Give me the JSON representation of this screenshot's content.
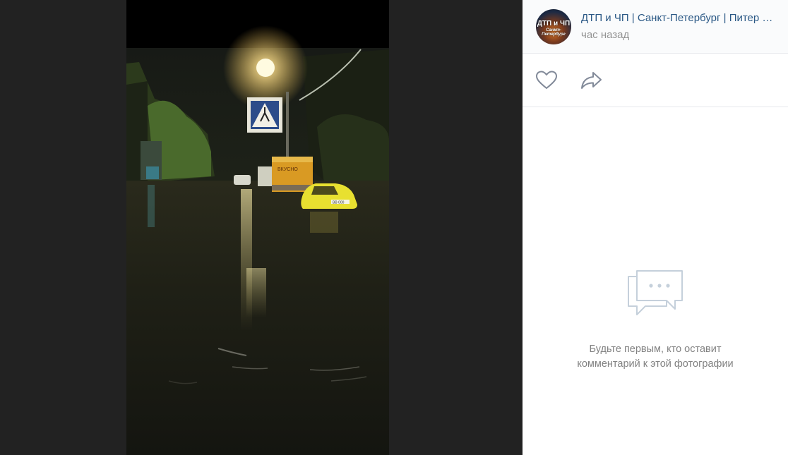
{
  "group": {
    "avatar_line1": "ДТП и ЧП",
    "avatar_line2": "Санкт-Петербург",
    "name": "ДТП и ЧП | Санкт-Петербург | Питер Онлайн | СПб",
    "time": "час назад"
  },
  "photo": {
    "car_plate": "ВВ 000"
  },
  "actions": {
    "like_icon": "heart-icon",
    "share_icon": "share-arrow-icon"
  },
  "comments": {
    "icon": "chat-bubbles-icon",
    "empty_line1": "Будьте первым, кто оставит",
    "empty_line2": "комментарий к этой фотографии"
  },
  "colors": {
    "link": "#2a5885",
    "muted": "#939393",
    "icon": "#828a99",
    "viewer_bg": "#222222"
  }
}
